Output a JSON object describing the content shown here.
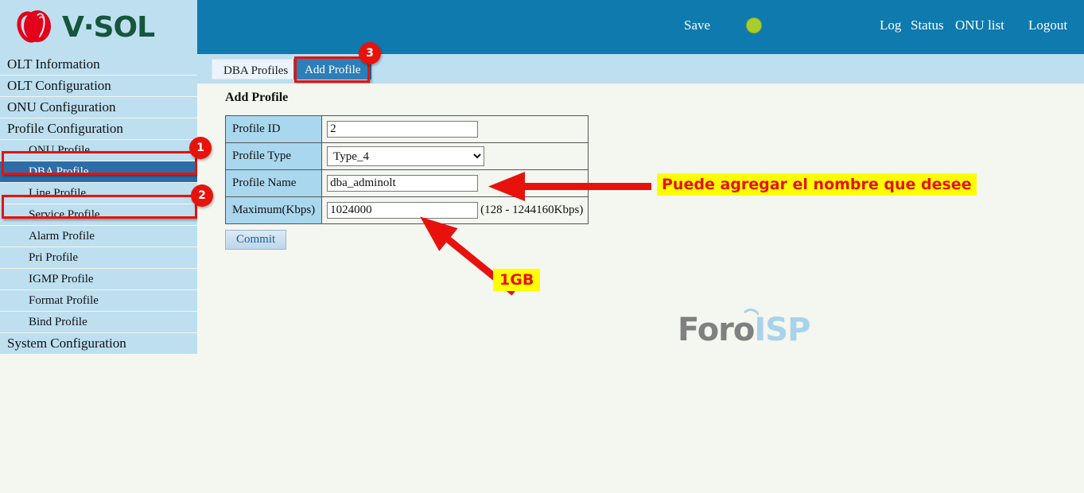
{
  "brand": {
    "logo_text": "V·SOL",
    "logo_mark_name": "vsol-logo-icon"
  },
  "topbar": {
    "save_label": "Save",
    "status_dot_color": "#A8CC2B",
    "log_label": "Log",
    "status_label": "Status",
    "onu_list_label": "ONU list",
    "logout_label": "Logout",
    "background": "#0E7AAE"
  },
  "tabs": [
    {
      "label": "DBA Profiles",
      "active": false
    },
    {
      "label": "Add Profile",
      "active": true
    }
  ],
  "sidebar": {
    "items": [
      {
        "label": "OLT Information",
        "level": 1,
        "selected": false
      },
      {
        "label": "OLT Configuration",
        "level": 1,
        "selected": false
      },
      {
        "label": "ONU Configuration",
        "level": 1,
        "selected": false
      },
      {
        "label": "Profile Configuration",
        "level": 1,
        "selected": false
      },
      {
        "label": "ONU Profile",
        "level": 2,
        "selected": false
      },
      {
        "label": "DBA Profile",
        "level": 2,
        "selected": true
      },
      {
        "label": "Line Profile",
        "level": 2,
        "selected": false
      },
      {
        "label": "Service Profile",
        "level": 2,
        "selected": false
      },
      {
        "label": "Alarm Profile",
        "level": 2,
        "selected": false
      },
      {
        "label": "Pri Profile",
        "level": 2,
        "selected": false
      },
      {
        "label": "IGMP Profile",
        "level": 2,
        "selected": false
      },
      {
        "label": "Format Profile",
        "level": 2,
        "selected": false
      },
      {
        "label": "Bind Profile",
        "level": 2,
        "selected": false
      },
      {
        "label": "System Configuration",
        "level": 1,
        "selected": false
      }
    ]
  },
  "main": {
    "title": "Add Profile",
    "fields": {
      "profile_id": {
        "label": "Profile ID",
        "value": "2"
      },
      "profile_type": {
        "label": "Profile Type",
        "value": "Type_4"
      },
      "profile_name": {
        "label": "Profile Name",
        "value": "dba_adminolt"
      },
      "maximum": {
        "label": "Maximum(Kbps)",
        "value": "1024000",
        "hint": "(128 - 1244160Kbps)"
      }
    },
    "commit_label": "Commit"
  },
  "annotations": {
    "badge_1": "1",
    "badge_2": "2",
    "badge_3": "3",
    "callout_name": "Puede agregar el nombre que desee",
    "callout_size": "1GB",
    "highlight_color": "#E8120C",
    "callout_bg": "#FFFF00",
    "callout_fg": "#E8120C"
  },
  "watermark": {
    "part1": "Foro",
    "part2": "ISP"
  }
}
